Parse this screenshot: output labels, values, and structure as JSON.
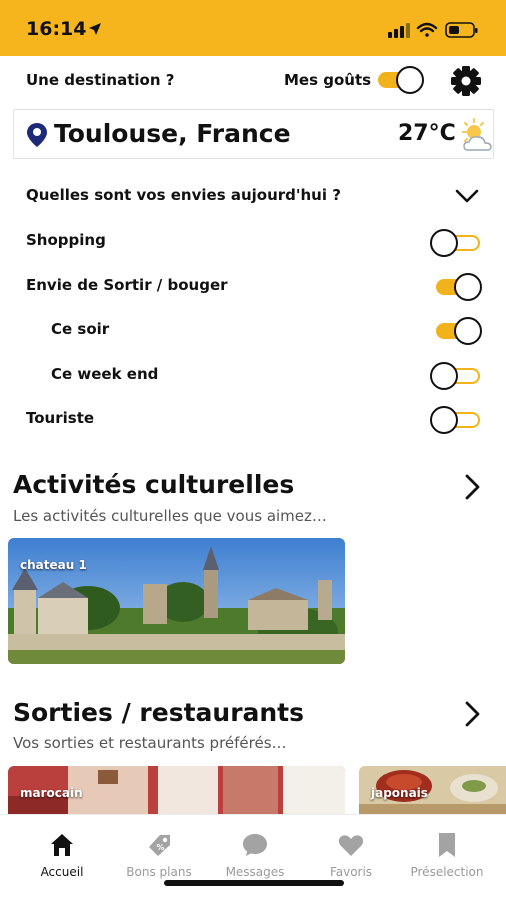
{
  "status_bar": {
    "time": "16:14"
  },
  "header": {
    "destination_label": "Une destination ?",
    "tastes_label": "Mes goûts",
    "tastes_toggle_on": true
  },
  "location": {
    "city": "Toulouse, France",
    "temperature": "27°C",
    "weather_icon": "partly-cloudy-icon"
  },
  "preferences": {
    "question": "Quelles sont vos envies aujourd'hui ?",
    "items": [
      {
        "label": "Shopping",
        "on": false
      },
      {
        "label": "Envie de Sortir / bouger",
        "on": true
      },
      {
        "label": "Ce soir",
        "on": true
      },
      {
        "label": "Ce week end",
        "on": false
      },
      {
        "label": "Touriste",
        "on": false
      }
    ]
  },
  "sections": [
    {
      "title": "Activités culturelles",
      "subtitle": "Les activités culturelles que vous aimez…",
      "cards": [
        "chateau 1"
      ]
    },
    {
      "title": "Sorties / restaurants",
      "subtitle": "Vos sorties et restaurants préférés…",
      "cards": [
        "marocain",
        "japonais"
      ]
    }
  ],
  "tabs": [
    {
      "label": "Accueil",
      "icon": "home-icon",
      "active": true
    },
    {
      "label": "Bons plans",
      "icon": "tag-icon",
      "active": false
    },
    {
      "label": "Messages",
      "icon": "chat-bubble-icon",
      "active": false
    },
    {
      "label": "Favoris",
      "icon": "heart-icon",
      "active": false
    },
    {
      "label": "Préselection",
      "icon": "bookmark-icon",
      "active": false
    }
  ],
  "colors": {
    "accent": "#f7b51d",
    "text": "#111111",
    "muted": "#9a9a9a"
  }
}
